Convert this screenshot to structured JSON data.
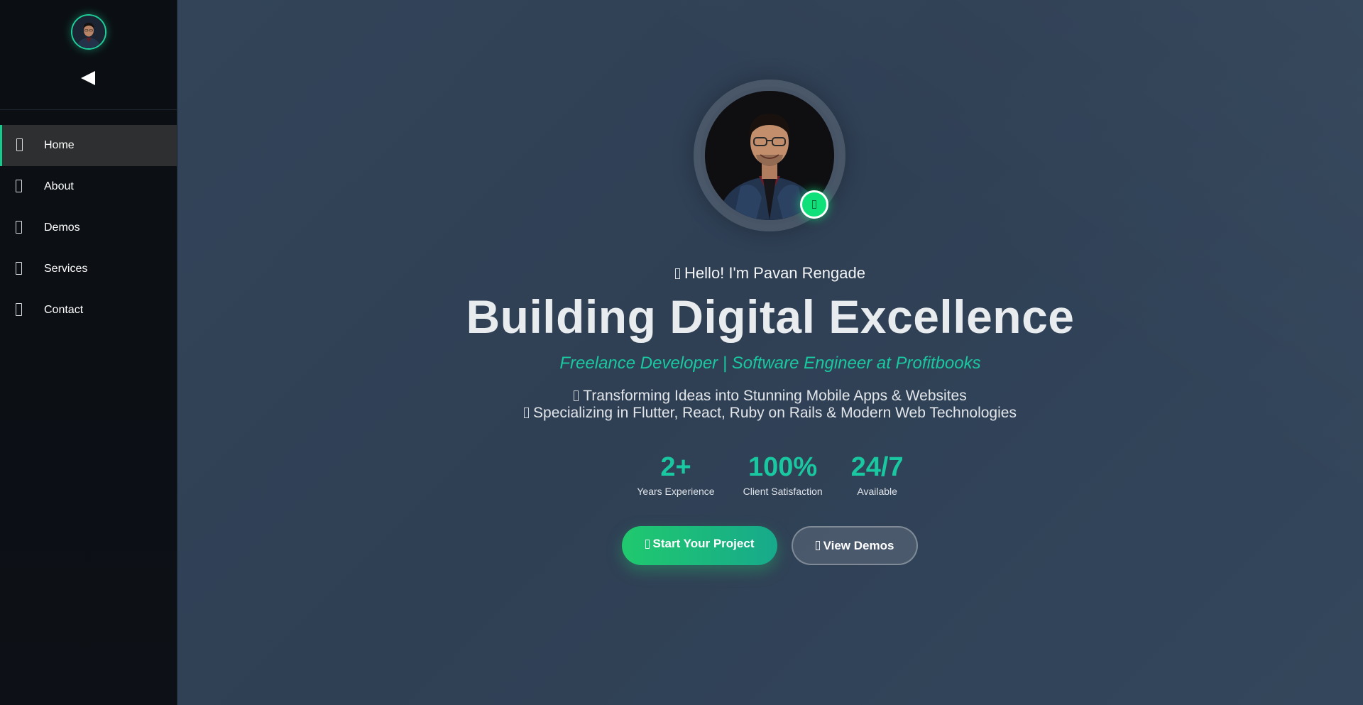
{
  "sidebar": {
    "collapse_icon": "triangle-left-icon",
    "items": [
      {
        "label": "Home",
        "icon": "home-icon",
        "active": true
      },
      {
        "label": "About",
        "icon": "user-icon",
        "active": false
      },
      {
        "label": "Demos",
        "icon": "laptop-icon",
        "active": false
      },
      {
        "label": "Services",
        "icon": "cog-icon",
        "active": false
      },
      {
        "label": "Contact",
        "icon": "envelope-icon",
        "active": false
      }
    ]
  },
  "hero": {
    "greeting": "Hello! I'm Pavan Rengade",
    "headline": "Building Digital Excellence",
    "tagline": "Freelance Developer | Software Engineer at Profitbooks",
    "description_lines": [
      "Transforming Ideas into Stunning Mobile Apps & Websites",
      "Specializing in Flutter, React, Ruby on Rails & Modern Web Technologies"
    ],
    "stats": [
      {
        "value": "2+",
        "label": "Years Experience"
      },
      {
        "value": "100%",
        "label": "Client Satisfaction"
      },
      {
        "value": "24/7",
        "label": "Available"
      }
    ],
    "primary_button": "Start Your Project",
    "secondary_button": "View Demos"
  },
  "colors": {
    "accent": "#19c7a0",
    "online_status": "#0fe07a",
    "sidebar_bg": "#0b0f13",
    "main_bg": "#2f3f52"
  }
}
